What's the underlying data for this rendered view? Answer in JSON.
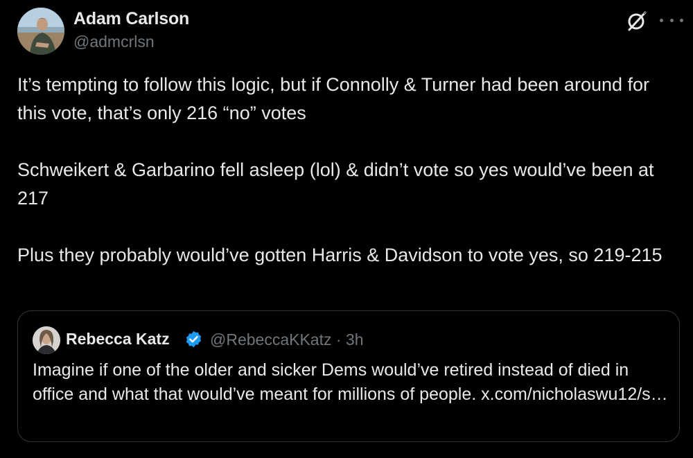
{
  "tweet": {
    "author": {
      "name": "Adam Carlson",
      "handle": "@admcrlsn"
    },
    "paragraphs": [
      "It’s tempting to follow this logic, but if Connolly & Turner had been around for this vote, that’s only 216 “no” votes",
      "Schweikert & Garbarino fell asleep (lol) & didn’t vote so yes would’ve been at 217",
      "Plus they probably would’ve gotten Harris & Davidson to vote yes, so 219-215"
    ],
    "icons": {
      "grok": "grok-icon",
      "more": "more-icon"
    }
  },
  "quote": {
    "author": {
      "name": "Rebecca Katz",
      "handle_time": "@RebeccaKKatz · 3h",
      "verified": true
    },
    "text": "Imagine if one of the older and sicker Dems would’ve retired instead of died in office and what that would’ve meant for millions of people. x.com/nicholaswu12/s…"
  },
  "colors": {
    "background": "#000000",
    "text_primary": "#e7e9ea",
    "text_secondary": "#71767b",
    "border": "#333639",
    "verified_blue": "#1d9bf0"
  }
}
